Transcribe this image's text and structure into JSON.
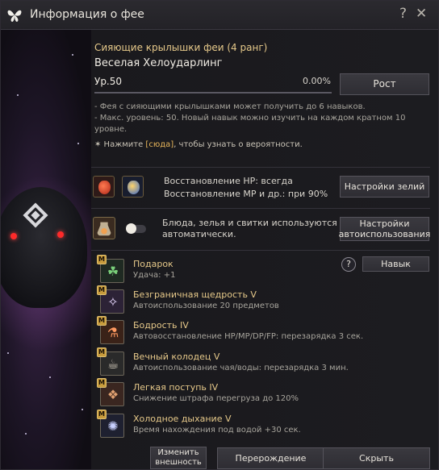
{
  "window": {
    "title": "Информация о фее",
    "help_glyph": "?",
    "close_glyph": "✕"
  },
  "fairy": {
    "section_title": "Сияющие крылышки феи (4 ранг)",
    "name": "Веселая Хелоударлинг",
    "level": "Ур.50",
    "exp_percent": "0.00%",
    "exp_fraction": 0.0,
    "grow_button": "Рост"
  },
  "notes": [
    "- Фея с сияющими крылышками может получить до 6 навыков.",
    "- Макс. уровень: 50. Новый навык можно изучить на каждом кратном 10 уровне."
  ],
  "hint": {
    "prefix": "✶ Нажмите ",
    "link": "[сюда]",
    "suffix": ", чтобы узнать о вероятности."
  },
  "potions": {
    "hp_line": "Восстановление HP: всегда",
    "mp_line": "Восстановление MP и др.: при 90%",
    "settings_button": "Настройки зелий"
  },
  "auto_use": {
    "text": "Блюда, зелья и свитки используются автоматически.",
    "toggle_on": false,
    "settings_button": "Настройки автоиспользования"
  },
  "skills_help": "?",
  "skill_button": "Навык",
  "skills": [
    {
      "badge": "M",
      "icon": "clover-icon",
      "glyph": "☘",
      "name": "Подарок",
      "desc": "Удача: +1"
    },
    {
      "badge": "M",
      "icon": "fairy-wing-icon",
      "glyph": "✧",
      "name": "Безграничная щедрость V",
      "desc": "Автоиспользование 20 предметов"
    },
    {
      "badge": "M",
      "icon": "flask-icon",
      "glyph": "⚗",
      "name": "Бодрость IV",
      "desc": "Автовосстановление HP/MP/DP/FP: перезарядка 3 сек."
    },
    {
      "badge": "M",
      "icon": "well-icon",
      "glyph": "☕",
      "name": "Вечный колодец V",
      "desc": "Автоиспользование чая/воды: перезарядка 3 мин."
    },
    {
      "badge": "M",
      "icon": "backpack-icon",
      "glyph": "❖",
      "name": "Легкая поступь IV",
      "desc": "Снижение штрафа перегруза до 120%"
    },
    {
      "badge": "M",
      "icon": "breath-icon",
      "glyph": "✺",
      "name": "Холодное дыхание V",
      "desc": "Время нахождения под водой +30 сек."
    }
  ],
  "footer": {
    "change_look": "Изменить внешность",
    "rebirth": "Перерождение",
    "hide": "Скрыть"
  },
  "colors": {
    "accent_gold": "#e6c98a",
    "hint_highlight": "#e6b55a",
    "eye_red": "#ff2a2a"
  }
}
